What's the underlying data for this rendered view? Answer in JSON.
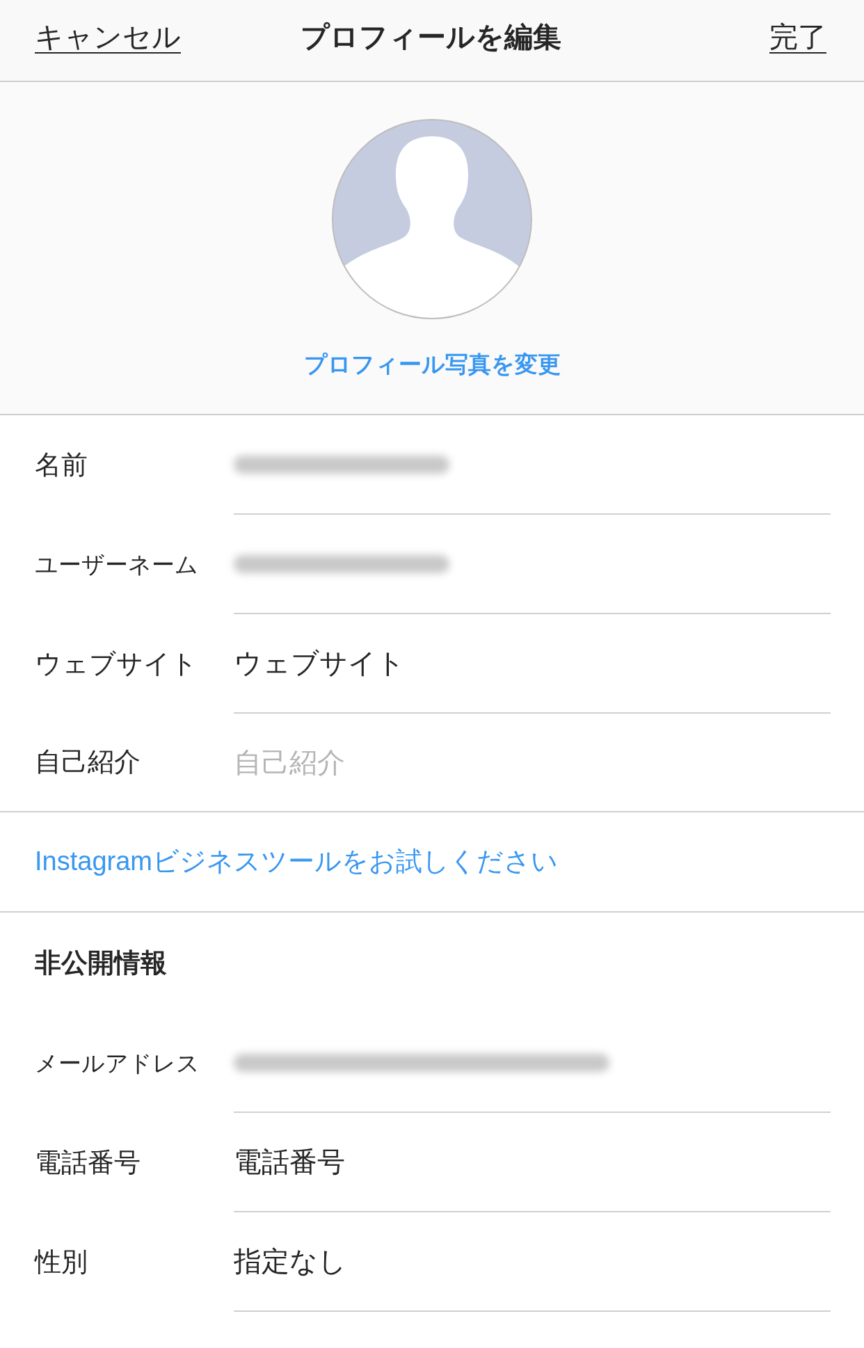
{
  "nav": {
    "cancel": "キャンセル",
    "title": "プロフィールを編集",
    "done": "完了"
  },
  "avatar": {
    "change_photo": "プロフィール写真を変更"
  },
  "profile_fields": [
    {
      "label": "名前",
      "kind": "blurred"
    },
    {
      "label": "ユーザーネーム",
      "kind": "blurred"
    },
    {
      "label": "ウェブサイト",
      "kind": "text",
      "value": "ウェブサイト"
    },
    {
      "label": "自己紹介",
      "kind": "placeholder",
      "placeholder": "自己紹介"
    }
  ],
  "business_link": "Instagramビジネスツールをお試しください",
  "private_info": {
    "title": "非公開情報",
    "fields": [
      {
        "label": "メールアドレス",
        "kind": "blurred"
      },
      {
        "label": "電話番号",
        "kind": "text",
        "value": "電話番号"
      },
      {
        "label": "性別",
        "kind": "text",
        "value": "指定なし"
      }
    ]
  }
}
